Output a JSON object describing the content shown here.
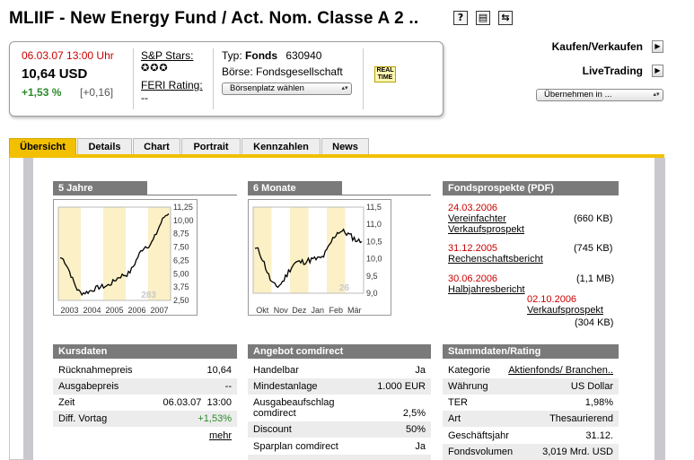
{
  "title": "MLIIF - New Energy Fund / Act. Nom. Classe A 2 ..",
  "title_icons": [
    "help-icon",
    "print-icon",
    "refresh-icon"
  ],
  "quote": {
    "datetime": "06.03.07 13:00 Uhr",
    "price": "10,64 USD",
    "change_pct": "+1,53 %",
    "change_abs": "[+0,16]",
    "sp_label": "S&P Stars:",
    "stars": "✪✪✪",
    "feri_label": "FERI Rating:",
    "feri_value": "--",
    "typ_label": "Typ:",
    "typ_value": "Fonds",
    "wkn": "630940",
    "boerse": "Börse: Fondsgesellschaft",
    "boersenplatz": "Börsenplatz wählen",
    "realtime": "REAL TIME"
  },
  "actions": {
    "kaufen": "Kaufen/Verkaufen",
    "livetrading": "LiveTrading",
    "uebernehmen": "Übernehmen in ..."
  },
  "tabs": [
    "Übersicht",
    "Details",
    "Chart",
    "Portrait",
    "Kennzahlen",
    "News"
  ],
  "chart5": {
    "title": "5 Jahre",
    "watermark": "283",
    "yticks": [
      "11,25",
      "10,00",
      "8,75",
      "7,50",
      "6,25",
      "5,00",
      "3,75",
      "2,50"
    ],
    "xticks": [
      "2003",
      "2004",
      "2005",
      "2006",
      "2007"
    ]
  },
  "chart6": {
    "title": "6 Monate",
    "watermark": "26",
    "yticks": [
      "11,5",
      "11,0",
      "10,5",
      "10,0",
      "9,5",
      "9,0"
    ],
    "xticks": [
      "Okt",
      "Nov",
      "Dez",
      "Jan",
      "Feb",
      "Mär"
    ]
  },
  "chart_data": [
    {
      "type": "line",
      "title": "5 Jahre",
      "ylim": [
        2.5,
        11.25
      ],
      "x": [
        "2002",
        "2003",
        "2004",
        "2005",
        "2006",
        "2007"
      ],
      "values": [
        6.5,
        3.2,
        3.8,
        4.9,
        7.6,
        10.64
      ]
    },
    {
      "type": "line",
      "title": "6 Monate",
      "ylim": [
        9.0,
        11.5
      ],
      "x": [
        "Okt",
        "Nov",
        "Dez",
        "Jan",
        "Feb",
        "Mär"
      ],
      "values": [
        10.3,
        9.2,
        9.9,
        10.0,
        10.8,
        10.5
      ]
    }
  ],
  "docs": {
    "title": "Fondsprospekte (PDF)",
    "items": [
      {
        "date": "24.03.2006",
        "name": "Vereinfachter Verkaufsprospekt",
        "size": "(660 KB)"
      },
      {
        "date": "31.12.2005",
        "name": "Rechenschaftsbericht",
        "size": "(745 KB)"
      },
      {
        "date": "30.06.2006",
        "name": "Halbjahresbericht",
        "size": "(1,1 MB)"
      },
      {
        "date": "02.10.2006",
        "name": "Verkaufsprospekt",
        "size": "(304 KB)"
      }
    ]
  },
  "kurs": {
    "title": "Kursdaten",
    "rows": [
      [
        "Rücknahmepreis",
        "10,64"
      ],
      [
        "Ausgabepreis",
        "--"
      ],
      [
        "Zeit",
        "06.03.07  13:00"
      ],
      [
        "Diff. Vortag",
        "+1,53%"
      ]
    ],
    "more": "mehr"
  },
  "angebot": {
    "title": "Angebot comdirect",
    "rows": [
      [
        "Handelbar",
        "Ja"
      ],
      [
        "Mindestanlage",
        "1.000 EUR"
      ],
      [
        "Ausgabeaufschlag comdirect",
        "2,5%"
      ],
      [
        "Discount",
        "50%"
      ],
      [
        "Sparplan comdirect",
        "Ja"
      ]
    ]
  },
  "stamm": {
    "title": "Stammdaten/Rating",
    "rows": [
      [
        "Kategorie",
        "Aktienfonds/ Branchen.."
      ],
      [
        "Währung",
        "US Dollar"
      ],
      [
        "TER",
        "1,98%"
      ],
      [
        "Art",
        "Thesaurierend"
      ],
      [
        "Geschäftsjahr",
        "31.12."
      ],
      [
        "Fondsvolumen",
        "3,019 Mrd. USD"
      ]
    ]
  },
  "colors": {
    "accent": "#f2c000",
    "header": "#7a7a7a",
    "red": "#cc0000",
    "green": "#2a8a2a"
  }
}
